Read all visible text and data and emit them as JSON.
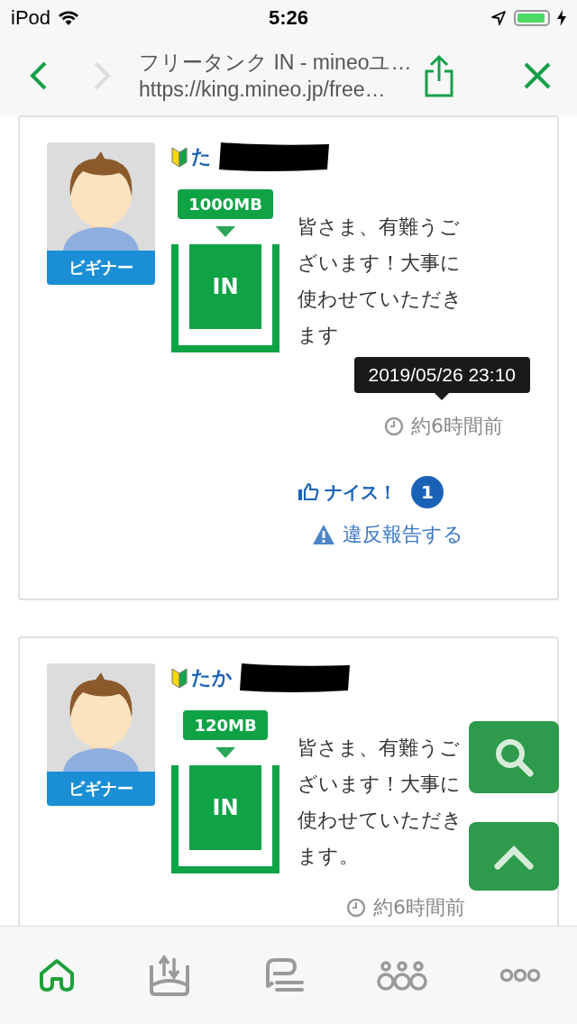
{
  "status_bar": {
    "carrier": "iPod",
    "time": "5:26",
    "charging": true
  },
  "nav": {
    "title": "フリータンク IN - mineoユ…",
    "url": "https://king.mineo.jp/free…",
    "back_disabled": false,
    "forward_disabled": true
  },
  "posts": [
    {
      "user": "た",
      "rank": "ビギナー",
      "amount": "1000MB",
      "action": "IN",
      "message": "皆さま、有難うございます！大事に使わせていただきます",
      "tooltip": "2019/05/26 23:10",
      "time": "約6時間前",
      "nice_label": "ナイス！",
      "nice_count": "1",
      "report": "違反報告する"
    },
    {
      "user": "たか",
      "rank": "ビギナー",
      "amount": "120MB",
      "action": "IN",
      "message": "皆さま、有難うございます！大事に使わせていただきます。",
      "time": "約6時間前"
    }
  ],
  "tabs": [
    {
      "kind": "home",
      "selected": true
    },
    {
      "kind": "tank",
      "selected": false
    },
    {
      "kind": "chat",
      "selected": false
    },
    {
      "kind": "groups",
      "selected": false
    },
    {
      "kind": "more",
      "selected": false
    }
  ]
}
